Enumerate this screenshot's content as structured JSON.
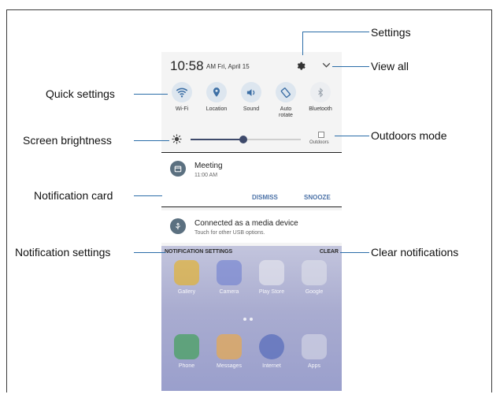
{
  "status": {
    "time": "10:58",
    "ampm_date": "AM Fri, April 15"
  },
  "quick_settings": [
    {
      "label": "Wi-Fi",
      "icon": "wifi-icon",
      "active": true
    },
    {
      "label": "Location",
      "icon": "location-icon",
      "active": true
    },
    {
      "label": "Sound",
      "icon": "sound-icon",
      "active": true
    },
    {
      "label": "Auto\nrotate",
      "icon": "rotate-icon",
      "active": true
    },
    {
      "label": "Bluetooth",
      "icon": "bluetooth-icon",
      "active": false
    }
  ],
  "brightness": {
    "level": 0.48,
    "outdoors_label": "Outdoors"
  },
  "notification_card": {
    "title": "Meeting",
    "time": "11:00 AM",
    "dismiss": "DISMISS",
    "snooze": "SNOOZE"
  },
  "usb_card": {
    "title": "Connected as a media device",
    "subtitle": "Touch for other USB options."
  },
  "notification_bar": {
    "settings": "NOTIFICATION SETTINGS",
    "clear": "CLEAR"
  },
  "home_apps": [
    {
      "label": "Gallery",
      "color": "#e8b21d"
    },
    {
      "label": "Camera",
      "color": "#6f7fd0"
    },
    {
      "label": "Play Store",
      "color": "#e9e9ef"
    },
    {
      "label": "Google",
      "color": "#dfe1ea"
    }
  ],
  "dock_apps": [
    {
      "label": "Phone",
      "color": "#35a04a"
    },
    {
      "label": "Messages",
      "color": "#f2a93b"
    },
    {
      "label": "Internet",
      "color": "#4a63b8"
    },
    {
      "label": "Apps",
      "color": "#d6d8e6"
    }
  ],
  "callouts": {
    "settings": "Settings",
    "view_all": "View all",
    "quick_settings": "Quick settings",
    "screen_brightness": "Screen brightness",
    "outdoors_mode": "Outdoors mode",
    "notification_card": "Notification card",
    "notification_settings": "Notification settings",
    "clear_notifications": "Clear notifications"
  },
  "colors": {
    "accent": "#4d73a8",
    "leader": "#2b6da8",
    "qs_circle": "#dde6ef",
    "qs_icon": "#3d6fa5"
  }
}
